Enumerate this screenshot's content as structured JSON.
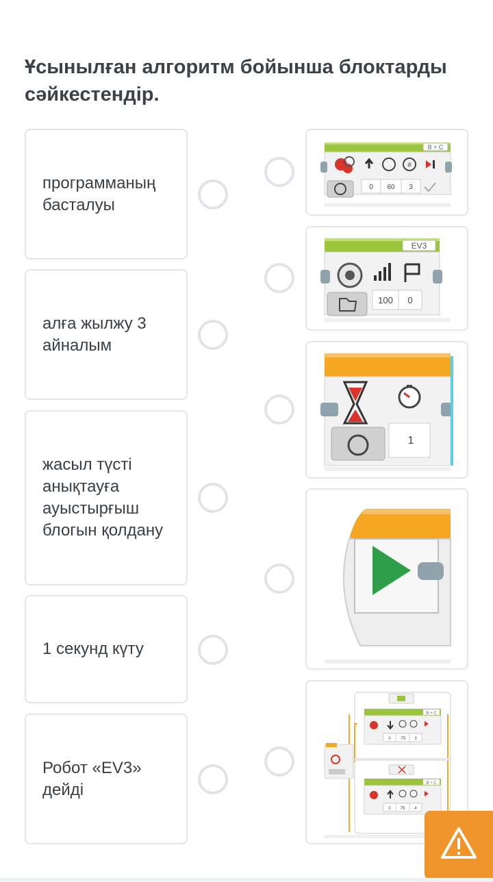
{
  "question": {
    "title": "Ұсынылған алгоритм бойынша блоктарды сәйкестендір."
  },
  "left_items": [
    {
      "label": "программаның\nбасталуы"
    },
    {
      "label": "алға жылжу 3\nайналым"
    },
    {
      "label": "жасыл түсті\nанықтауға\nауыстырғыш\nблогын қолдану"
    },
    {
      "label": "1 секунд күту"
    },
    {
      "label": "Робот «EV3»\nдейді"
    }
  ],
  "right_items": [
    {
      "icon": "move-steering-block-icon",
      "port": "B + C",
      "values": [
        "0",
        "60",
        "3"
      ]
    },
    {
      "icon": "sound-block-icon",
      "port": "EV3",
      "values": [
        "100",
        "0"
      ]
    },
    {
      "icon": "wait-timer-block-icon",
      "values": [
        "1"
      ]
    },
    {
      "icon": "start-block-icon"
    },
    {
      "icon": "switch-block-icon",
      "port_top": "B + C",
      "values_top": [
        "0",
        "-75",
        "3"
      ],
      "port_bottom": "B + C",
      "values_bottom": [
        "0",
        "75",
        "4"
      ]
    }
  ],
  "warning_button": {
    "icon": "warning-icon"
  },
  "colors": {
    "title": "#3d4249",
    "text": "#3a3f46",
    "border": "#e3e6ea",
    "radio": "#e0e3e7",
    "accent": "#f0952c",
    "block_green": "#9bc53d",
    "block_orange": "#f5a623"
  }
}
